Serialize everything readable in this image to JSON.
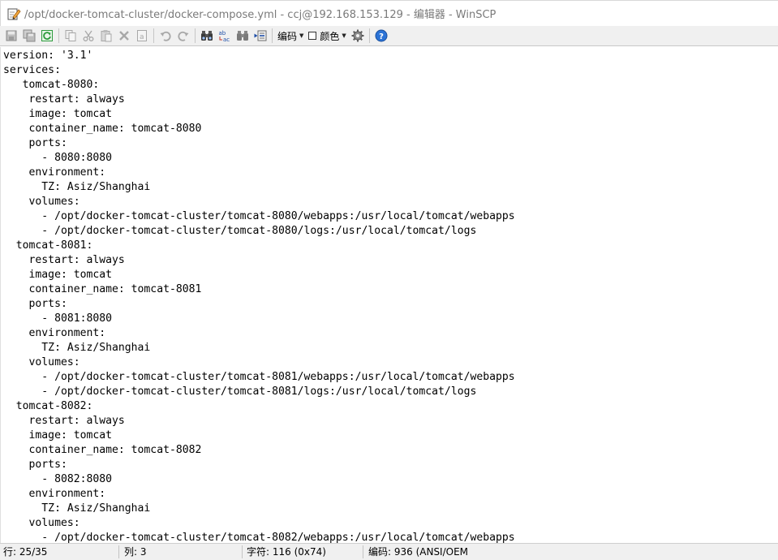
{
  "window": {
    "title": "/opt/docker-tomcat-cluster/docker-compose.yml - ccj@192.168.153.129 - 编辑器 - WinSCP",
    "title_icon": "edit-document-icon"
  },
  "toolbar": {
    "encoding_label": "编码",
    "color_label": "颜色",
    "icons": [
      "save-icon",
      "save-all-icon",
      "reload-icon",
      "copy-icon",
      "cut-icon",
      "paste-icon",
      "delete-icon",
      "select-all-icon",
      "undo-icon",
      "redo-icon",
      "find-icon",
      "replace-icon",
      "find-next-icon",
      "goto-line-icon",
      "settings-icon",
      "help-icon"
    ]
  },
  "editor": {
    "lines": [
      "version: '3.1'",
      "services:",
      "   tomcat-8080:",
      "    restart: always",
      "    image: tomcat",
      "    container_name: tomcat-8080",
      "    ports:",
      "      - 8080:8080",
      "    environment:",
      "      TZ: Asiz/Shanghai",
      "    volumes:",
      "      - /opt/docker-tomcat-cluster/tomcat-8080/webapps:/usr/local/tomcat/webapps",
      "      - /opt/docker-tomcat-cluster/tomcat-8080/logs:/usr/local/tomcat/logs",
      "  tomcat-8081:",
      "    restart: always",
      "    image: tomcat",
      "    container_name: tomcat-8081",
      "    ports:",
      "      - 8081:8080",
      "    environment:",
      "      TZ: Asiz/Shanghai",
      "    volumes:",
      "      - /opt/docker-tomcat-cluster/tomcat-8081/webapps:/usr/local/tomcat/webapps",
      "      - /opt/docker-tomcat-cluster/tomcat-8081/logs:/usr/local/tomcat/logs",
      "  tomcat-8082:",
      "    restart: always",
      "    image: tomcat",
      "    container_name: tomcat-8082",
      "    ports:",
      "      - 8082:8080",
      "    environment:",
      "      TZ: Asiz/Shanghai",
      "    volumes:",
      "      - /opt/docker-tomcat-cluster/tomcat-8082/webapps:/usr/local/tomcat/webapps"
    ]
  },
  "statusbar": {
    "line": "行: 25/35",
    "column": "列: 3",
    "char": "字符: 116 (0x74)",
    "encoding": "编码:  936  (ANSI/OEM"
  },
  "colors": {
    "toolbar_bg": "#f0f0f0",
    "help_blue": "#2b73d6",
    "reload_green": "#2c9b3c",
    "title_text": "#7a7a7a"
  }
}
